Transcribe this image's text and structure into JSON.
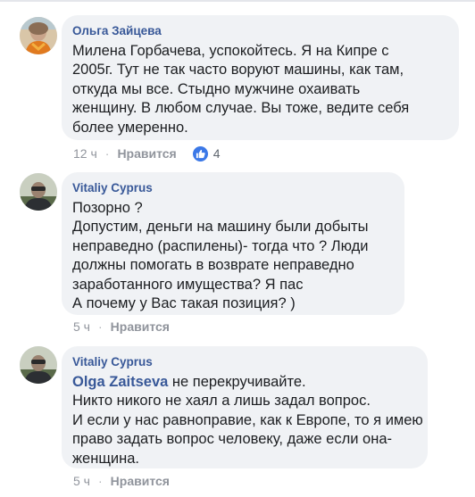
{
  "colors": {
    "bubble": "#f0f2f5",
    "author": "#385898",
    "meta": "#90949c",
    "like": "#3b78e7"
  },
  "comments": [
    {
      "author": "Ольга Зайцева",
      "avatar_icon": "user-photo-woman",
      "lines": [
        "Милена Горбачева, успокойтесь. Я на Кипре с",
        "2005г. Тут не так часто воруют машины, как там,",
        "откуда мы все. Стыдно мужчине охаивать",
        "женщину. В любом случае. Вы тоже, ведите себя",
        "более умеренно."
      ],
      "time": "12 ч",
      "like_label": "Нравится",
      "reaction_icon": "thumbs-up-icon",
      "reaction_count": "4"
    },
    {
      "author": "Vitaliy Cyprus",
      "avatar_icon": "user-photo-man",
      "lines": [
        "Позорно ?",
        "Допустим, деньги на машину были  добыты",
        "неправедно (распилены)- тогда что ? Люди",
        "должны помогать в возврате неправедно",
        "заработанного имущества? Я пас",
        "А почему у Вас такая позиция? )"
      ],
      "time": "5 ч",
      "like_label": "Нравится"
    },
    {
      "author": "Vitaliy Cyprus",
      "avatar_icon": "user-photo-man",
      "mention": "Olga Zaitseva",
      "first_line_rest": " не перекручивайте.",
      "lines": [
        "Никто никого не хаял а лишь задал вопрос.",
        "И если у нас равноправие, как к Европе, то я имею",
        "право задать вопрос человеку, даже если она-",
        "женщина."
      ],
      "time": "5 ч",
      "like_label": "Нравится"
    }
  ]
}
